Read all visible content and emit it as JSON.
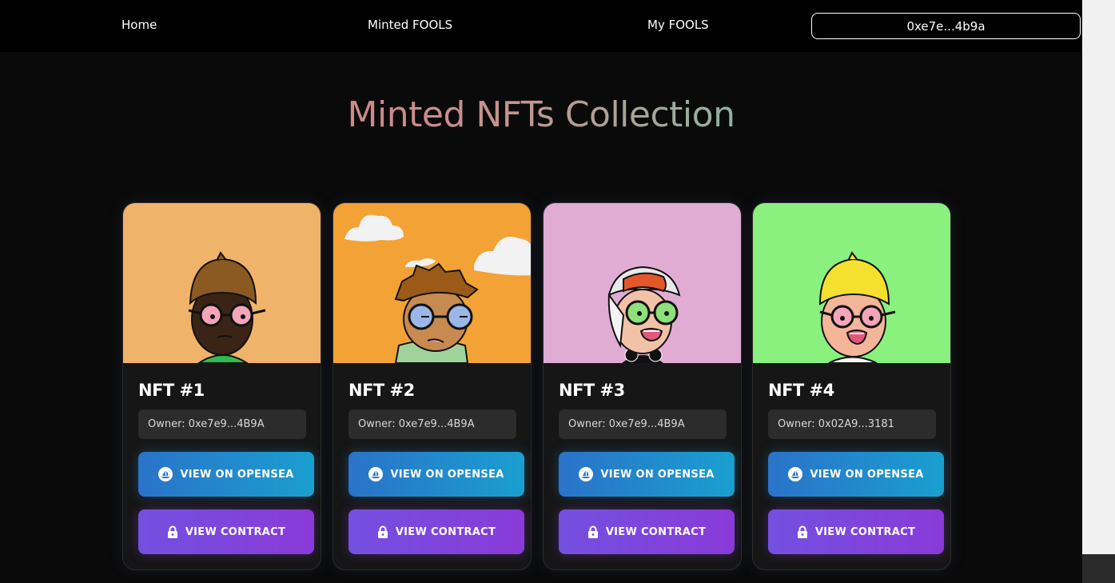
{
  "nav": {
    "home": "Home",
    "minted": "Minted FOOLS",
    "my": "My FOOLS",
    "wallet": "0xe7e...4b9a"
  },
  "page": {
    "title": "Minted NFTs Collection"
  },
  "colors": {
    "opensea_start": "#2a73c9",
    "opensea_end": "#1a9fcf",
    "contract_start": "#7350e0",
    "contract_end": "#8a3ad8"
  },
  "cards": [
    {
      "title": "NFT #1",
      "owner": "Owner: 0xe7e9...4B9A",
      "opensea": "VIEW ON OPENSEA",
      "contract": "VIEW CONTRACT",
      "bg": "#f0b36a"
    },
    {
      "title": "NFT #2",
      "owner": "Owner: 0xe7e9...4B9A",
      "opensea": "VIEW ON OPENSEA",
      "contract": "VIEW CONTRACT",
      "bg": "#f3a236"
    },
    {
      "title": "NFT #3",
      "owner": "Owner: 0xe7e9...4B9A",
      "opensea": "VIEW ON OPENSEA",
      "contract": "VIEW CONTRACT",
      "bg": "#e1acd4"
    },
    {
      "title": "NFT #4",
      "owner": "Owner: 0x02A9...3181",
      "opensea": "VIEW ON OPENSEA",
      "contract": "VIEW CONTRACT",
      "bg": "#8af07e"
    }
  ]
}
